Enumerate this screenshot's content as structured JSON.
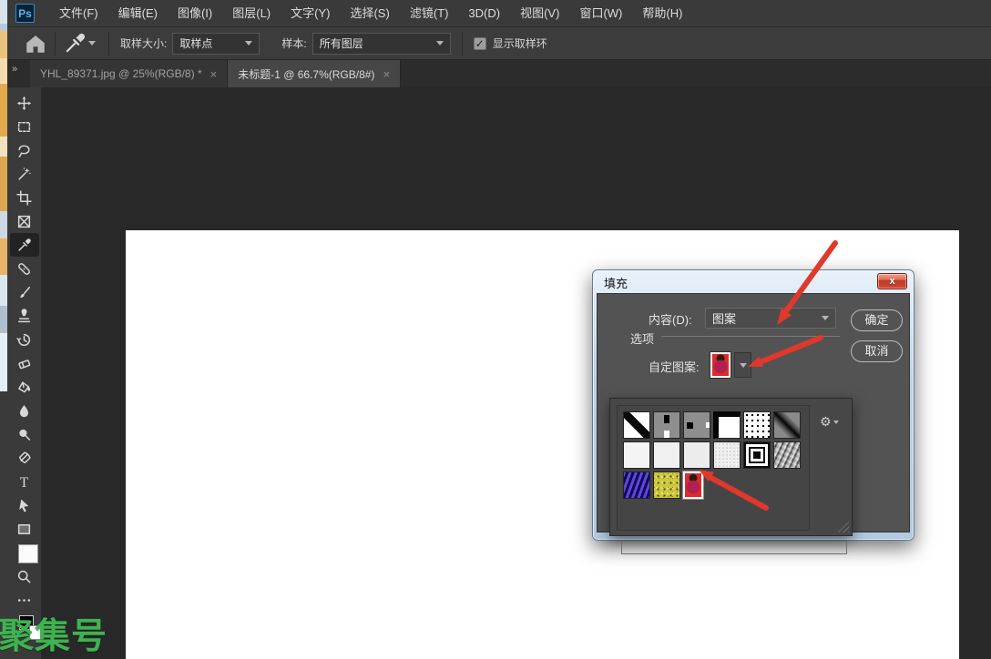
{
  "menu_bar": {
    "logo_text": "Ps",
    "items": [
      "文件(F)",
      "编辑(E)",
      "图像(I)",
      "图层(L)",
      "文字(Y)",
      "选择(S)",
      "滤镜(T)",
      "3D(D)",
      "视图(V)",
      "窗口(W)",
      "帮助(H)"
    ]
  },
  "options_bar": {
    "sample_size_label": "取样大小:",
    "sample_size_value": "取样点",
    "sample_label": "样本:",
    "sample_value": "所有图层",
    "show_sampling_ring_label": "显示取样环",
    "show_sampling_ring_checked": true,
    "check_glyph": "✓"
  },
  "tab_bar": {
    "collapse_glyph": "»",
    "tabs": [
      {
        "label": "YHL_89371.jpg @ 25%(RGB/8) *",
        "close_glyph": "×",
        "active": false
      },
      {
        "label": "未标题-1 @ 66.7%(RGB/8#)",
        "close_glyph": "×",
        "active": true
      }
    ]
  },
  "toolbar": {
    "active_tool": "eyedropper",
    "tools": [
      "move",
      "marquee",
      "lasso",
      "quick-selection",
      "crop",
      "frame",
      "eyedropper",
      "spot-healing",
      "brush",
      "clone-stamp",
      "history-brush",
      "eraser",
      "paint-bucket",
      "blur",
      "dodge",
      "pen",
      "type",
      "path-selection",
      "rectangle",
      "hand",
      "zoom",
      "edit-toolbar"
    ]
  },
  "fill_dialog": {
    "title": "填充",
    "close_glyph": "x",
    "content_label": "内容(D):",
    "content_value": "图案",
    "ok_label": "确定",
    "cancel_label": "取消",
    "options_group_label": "选项",
    "custom_pattern_label": "自定图案:",
    "gear_glyph": "⚙",
    "pattern_picker": {
      "selected": "custom-portrait-red",
      "patterns": [
        {
          "name": "diagonal-line"
        },
        {
          "name": "vertical-bar"
        },
        {
          "name": "square-and-bar"
        },
        {
          "name": "corner-frame"
        },
        {
          "name": "polka-dots"
        },
        {
          "name": "diagonal-gradient"
        },
        {
          "name": "white-1"
        },
        {
          "name": "white-2"
        },
        {
          "name": "white-3"
        },
        {
          "name": "fine-noise"
        },
        {
          "name": "concentric-squares"
        },
        {
          "name": "gray-crinkle"
        },
        {
          "name": "blue-waves"
        },
        {
          "name": "yellow-speckle"
        },
        {
          "name": "custom-portrait-red"
        }
      ]
    }
  },
  "watermark": "聚集号",
  "colors": {
    "arrow_red": "#e0382b",
    "watermark_green": "#3eb350",
    "dialog_chrome_blue": "#bed3e8",
    "workspace_gray": "#282828"
  }
}
